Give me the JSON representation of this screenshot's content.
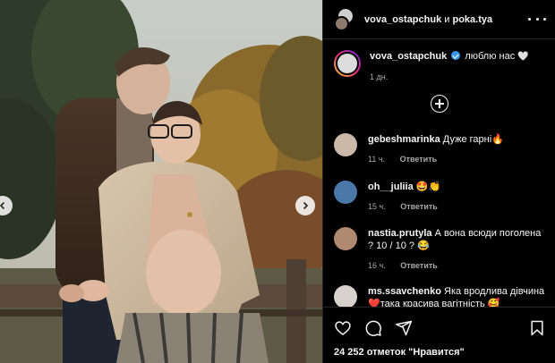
{
  "header": {
    "user1": "vova_ostapchuk",
    "and": "и",
    "user2": "poka.tya"
  },
  "caption": {
    "username": "vova_ostapchuk",
    "text": "люблю нас",
    "heart": "🤍",
    "time": "1 дн."
  },
  "comments": [
    {
      "username": "gebeshmarinka",
      "text": "Дуже гарні",
      "emoji": "🔥",
      "time": "11 ч.",
      "reply": "Ответить",
      "avatar_color": "#c9b9a6"
    },
    {
      "username": "oh__juliia",
      "text": "",
      "emoji": "🤩👏",
      "time": "15 ч.",
      "reply": "Ответить",
      "avatar_color": "#4a78a8"
    },
    {
      "username": "nastia.prutyla",
      "text": "А вона всюди поголена ? 10 / 10 ?",
      "emoji": "😂",
      "time": "16 ч.",
      "reply": "Ответить",
      "avatar_color": "#b08a70"
    },
    {
      "username": "ms.ssavchenko",
      "text": "Яка вродлива дівчина",
      "text2": "така красива вагітність",
      "emoji_pre": "❤️",
      "emoji": "🥰",
      "time": "",
      "reply": "",
      "avatar_color": "#d8d2cc"
    }
  ],
  "likes": {
    "count": "24 252",
    "label": "отметок \"Нравится\""
  },
  "icons": {
    "like": "heart-icon",
    "comment": "comment-icon",
    "share": "share-icon",
    "save": "bookmark-icon",
    "more": "more-icon",
    "add": "plus-circle-icon",
    "prev": "chevron-left-icon",
    "next": "chevron-right-icon"
  },
  "colors": {
    "background": "#000000",
    "text": "#f5f5f5",
    "muted": "#a8a8a8",
    "verified": "#3897f0",
    "divider": "#262626"
  }
}
